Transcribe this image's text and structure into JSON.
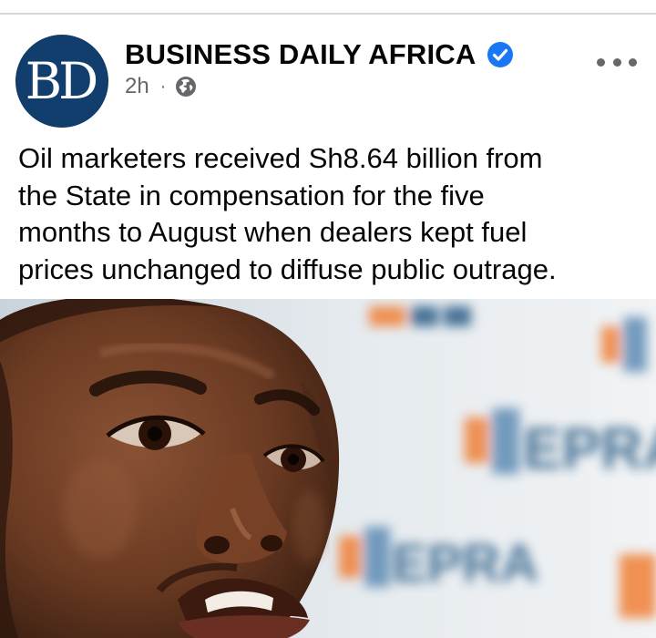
{
  "post": {
    "page_name": "BUSINESS DAILY AFRICA",
    "avatar_text": "BD",
    "timestamp": "2h",
    "separator": "·",
    "privacy_icon": "globe-icon",
    "verified_icon": "verified-badge-icon",
    "more_icon": "more-options-icon",
    "text_lines": [
      "Oil marketers received Sh8.64 billion from",
      "the State in compensation for the five",
      "months to August when dealers kept fuel",
      "prices unchanged to diffuse public outrage."
    ],
    "image_backdrop_logos": [
      "EPRA",
      "EPRA",
      "EPRA"
    ]
  },
  "colors": {
    "brand_blue": "#123e6d",
    "verified_blue": "#1877f2",
    "meta_gray": "#65676b",
    "text": "#050505"
  }
}
